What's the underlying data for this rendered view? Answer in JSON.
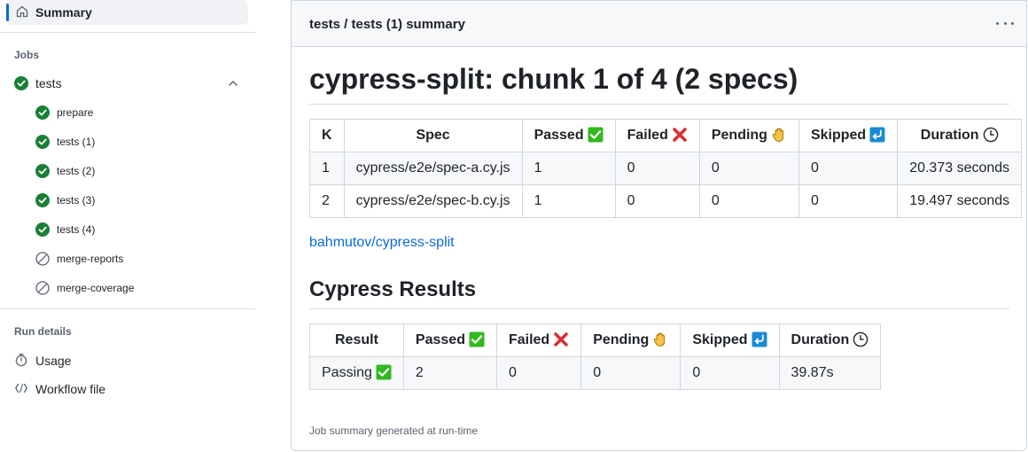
{
  "sidebar": {
    "summary_label": "Summary",
    "jobs_title": "Jobs",
    "job": {
      "name": "tests",
      "status": "success"
    },
    "subjobs": [
      {
        "name": "prepare",
        "status": "success"
      },
      {
        "name": "tests (1)",
        "status": "success"
      },
      {
        "name": "tests (2)",
        "status": "success"
      },
      {
        "name": "tests (3)",
        "status": "success"
      },
      {
        "name": "tests (4)",
        "status": "success"
      },
      {
        "name": "merge-reports",
        "status": "skipped"
      },
      {
        "name": "merge-coverage",
        "status": "skipped"
      }
    ],
    "run_details_title": "Run details",
    "details": [
      {
        "name": "Usage",
        "icon": "stopwatch-icon"
      },
      {
        "name": "Workflow file",
        "icon": "file-code-icon"
      }
    ]
  },
  "card": {
    "header_title": "tests / tests (1) summary",
    "heading": "cypress-split: chunk 1 of 4 (2 specs)",
    "spec_table": {
      "headers": [
        "K",
        "Spec",
        "Passed",
        "Failed",
        "Pending",
        "Skipped",
        "Duration"
      ],
      "rows": [
        [
          "1",
          "cypress/e2e/spec-a.cy.js",
          "1",
          "0",
          "0",
          "0",
          "20.373 seconds"
        ],
        [
          "2",
          "cypress/e2e/spec-b.cy.js",
          "1",
          "0",
          "0",
          "0",
          "19.497 seconds"
        ]
      ]
    },
    "link_text": "bahmutov/cypress-split",
    "results_heading": "Cypress Results",
    "results_table": {
      "headers": [
        "Result",
        "Passed",
        "Failed",
        "Pending",
        "Skipped",
        "Duration"
      ],
      "row": [
        "Passing",
        "2",
        "0",
        "0",
        "0",
        "39.87s"
      ]
    },
    "footer": "Job summary generated at run-time"
  },
  "colors": {
    "success": "#1a7f37",
    "accent": "#0969da",
    "border": "#d0d7de",
    "muted": "#59636e"
  }
}
